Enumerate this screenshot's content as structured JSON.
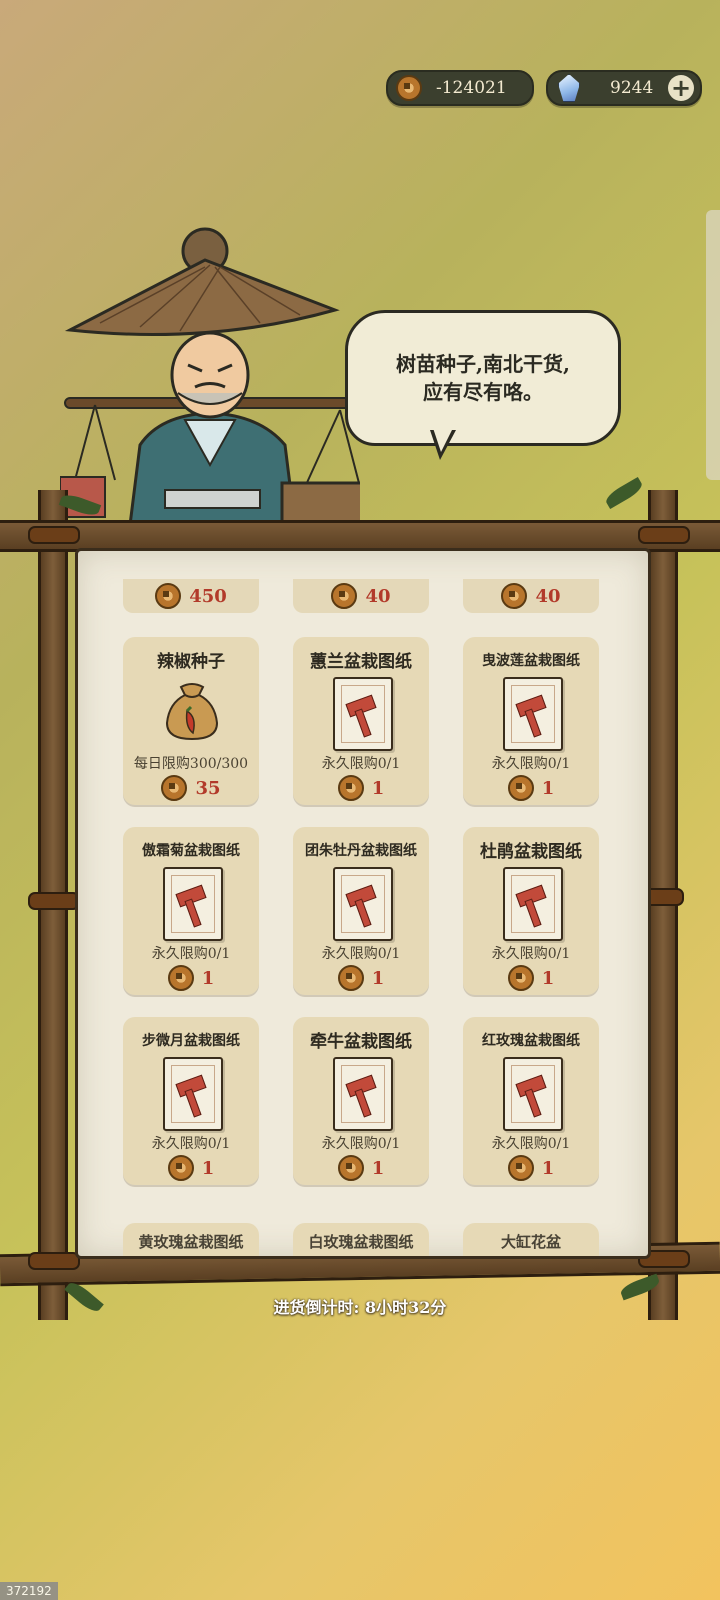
{
  "currency": {
    "coins": "-124021",
    "gems": "9244",
    "add_label": "+"
  },
  "merchant": {
    "speech_line1": "树苗种子,南北干货,",
    "speech_line2": "应有尽有咯。"
  },
  "shop": {
    "top_prices": [
      "450",
      "40",
      "40"
    ],
    "items": [
      {
        "name": "辣椒种子",
        "limit": "每日限购300/300",
        "price": "35",
        "icon": "seed-sack-icon"
      },
      {
        "name": "蕙兰盆栽图纸",
        "limit": "永久限购0/1",
        "price": "1",
        "icon": "blueprint-hammer-icon"
      },
      {
        "name": "曳波莲盆栽图纸",
        "limit": "永久限购0/1",
        "price": "1",
        "icon": "blueprint-hammer-icon"
      },
      {
        "name": "傲霜菊盆栽图纸",
        "limit": "永久限购0/1",
        "price": "1",
        "icon": "blueprint-hammer-icon"
      },
      {
        "name": "团朱牡丹盆栽图纸",
        "limit": "永久限购0/1",
        "price": "1",
        "icon": "blueprint-hammer-icon"
      },
      {
        "name": "杜鹃盆栽图纸",
        "limit": "永久限购0/1",
        "price": "1",
        "icon": "blueprint-hammer-icon"
      },
      {
        "name": "步微月盆栽图纸",
        "limit": "永久限购0/1",
        "price": "1",
        "icon": "blueprint-hammer-icon"
      },
      {
        "name": "牵牛盆栽图纸",
        "limit": "永久限购0/1",
        "price": "1",
        "icon": "blueprint-hammer-icon"
      },
      {
        "name": "红玫瑰盆栽图纸",
        "limit": "永久限购0/1",
        "price": "1",
        "icon": "blueprint-hammer-icon"
      }
    ],
    "partial_row": [
      "黄玫瑰盆栽图纸",
      "白玫瑰盆栽图纸",
      "大缸花盆"
    ]
  },
  "countdown": "进货倒计时: 8小时32分",
  "stamp": "372192",
  "colors": {
    "price_red": "#b23a2a",
    "frame_wood": "#6b4a2a",
    "paper": "#efeadb"
  }
}
